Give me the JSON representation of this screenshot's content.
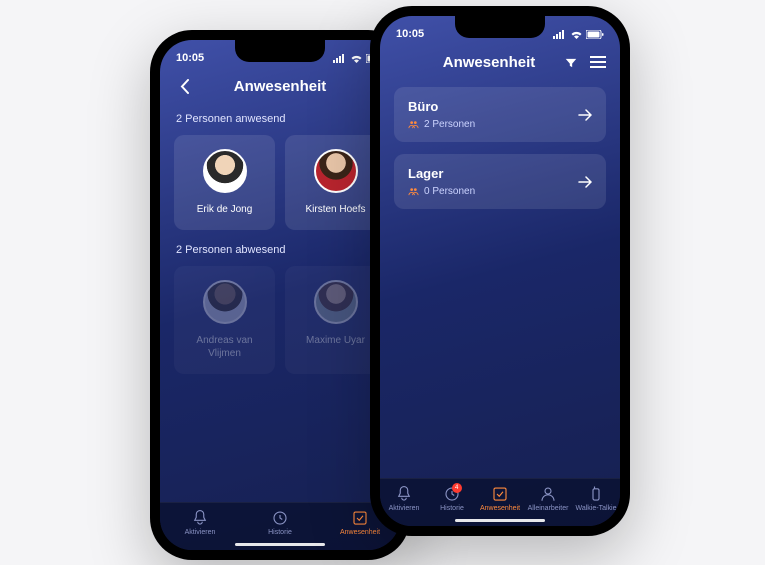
{
  "status": {
    "time": "10:05"
  },
  "left": {
    "title": "Anwesenheit",
    "present_label": "2 Personen anwesend",
    "absent_label": "2 Personen abwesend",
    "present": [
      {
        "name": "Erik de Jong"
      },
      {
        "name": "Kirsten Hoefs"
      }
    ],
    "absent": [
      {
        "name": "Andreas van Vlijmen"
      },
      {
        "name": "Maxime Uyar"
      }
    ],
    "nav": [
      {
        "label": "Aktivieren"
      },
      {
        "label": "Historie"
      },
      {
        "label": "Anwesenheit"
      }
    ]
  },
  "right": {
    "title": "Anwesenheit",
    "locations": [
      {
        "name": "Büro",
        "count": "2 Personen"
      },
      {
        "name": "Lager",
        "count": "0 Personen"
      }
    ],
    "nav": [
      {
        "label": "Aktivieren"
      },
      {
        "label": "Historie",
        "badge": "4"
      },
      {
        "label": "Anwesenheit"
      },
      {
        "label": "Alleinarbeiter"
      },
      {
        "label": "Walkie-Talkie"
      }
    ]
  }
}
